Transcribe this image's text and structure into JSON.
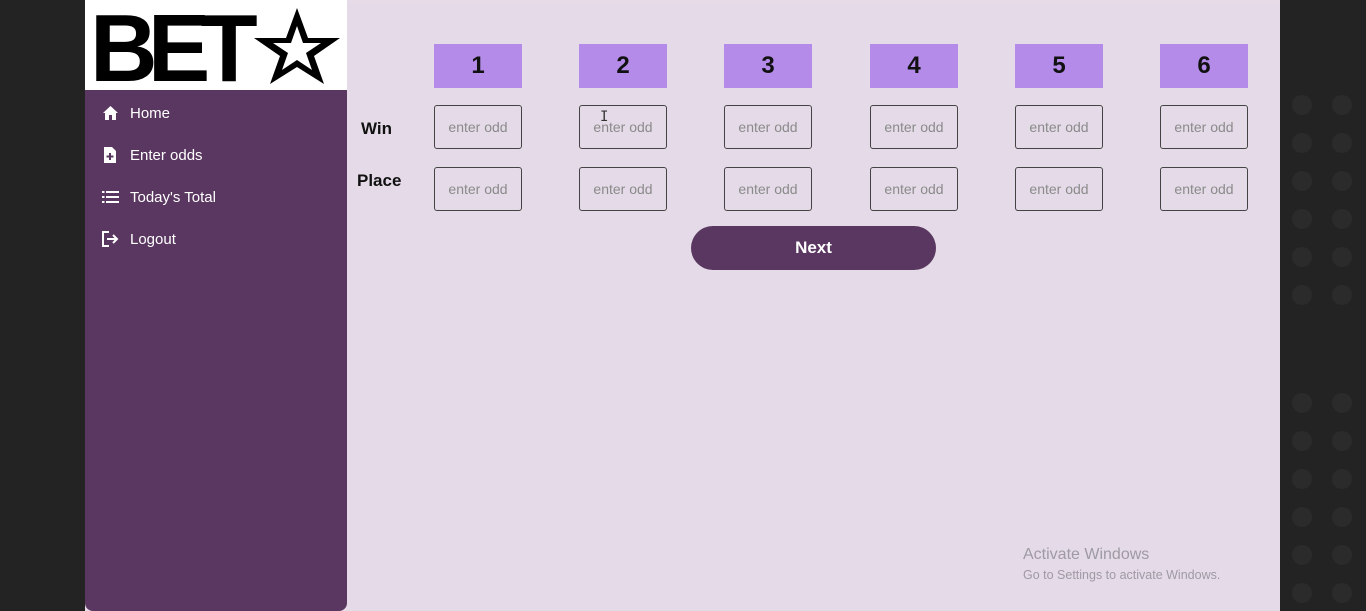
{
  "brand": {
    "logo_text": "BET",
    "logo_icon": "star-icon"
  },
  "sidebar": {
    "items": [
      {
        "label": "Home",
        "icon": "home-icon"
      },
      {
        "label": "Enter odds",
        "icon": "file-plus-icon"
      },
      {
        "label": "Today's Total",
        "icon": "list-icon"
      },
      {
        "label": "Logout",
        "icon": "logout-icon"
      }
    ]
  },
  "grid": {
    "columns": [
      "1",
      "2",
      "3",
      "4",
      "5",
      "6"
    ],
    "rows": [
      {
        "label": "Win",
        "placeholder": "enter odd"
      },
      {
        "label": "Place",
        "placeholder": "enter odd"
      }
    ]
  },
  "actions": {
    "next_label": "Next"
  },
  "watermark": {
    "title": "Activate Windows",
    "subtitle": "Go to Settings to activate Windows."
  },
  "colors": {
    "sidebar": "#5a3760",
    "accent": "#b48be8",
    "background": "#e5dbe8"
  }
}
